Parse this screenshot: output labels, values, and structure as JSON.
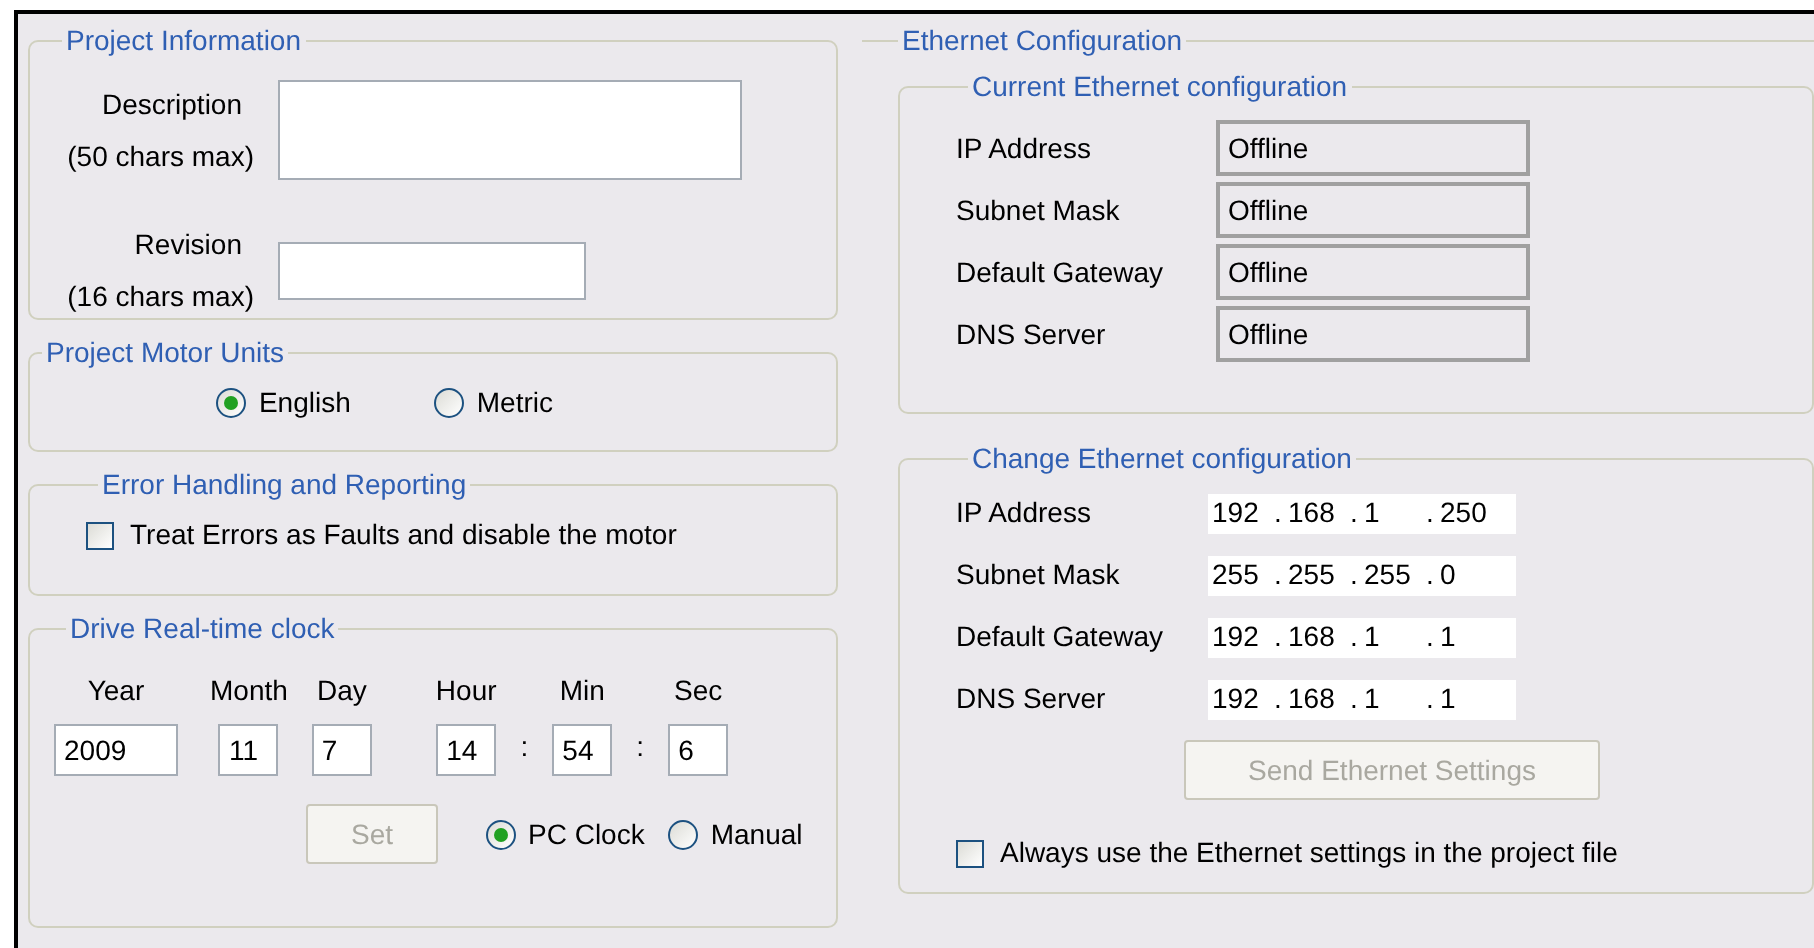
{
  "project_information": {
    "title": "Project Information",
    "fields": [
      {
        "kind": "multiline",
        "label": "Description",
        "limit": "(50 chars max)"
      },
      {
        "kind": "single",
        "label": "Revision",
        "limit": "(16 chars max)"
      }
    ]
  },
  "motor_units": {
    "title": "Project Motor Units",
    "options": [
      {
        "label": "English",
        "selected": true
      },
      {
        "label": "Metric",
        "selected": false
      }
    ]
  },
  "error_handling": {
    "title": "Error Handling and Reporting",
    "checkbox": {
      "label": "Treat Errors as Faults and disable the motor",
      "checked": false
    }
  },
  "real_time_clock": {
    "title": "Drive Real-time clock",
    "fields": [
      {
        "label": "Year",
        "value": "2009"
      },
      {
        "label": "Month",
        "value": "11"
      },
      {
        "label": "Day",
        "value": "7"
      },
      {
        "label": "Hour",
        "value": "14"
      },
      {
        "label": "Min",
        "value": "54",
        "separator_before": ":"
      },
      {
        "label": "Sec",
        "value": "6",
        "separator_before": ":"
      }
    ],
    "set_button": {
      "label": "Set",
      "disabled": true
    },
    "sources": [
      {
        "label": "PC Clock",
        "selected": true
      },
      {
        "label": "Manual",
        "selected": false
      }
    ]
  },
  "ethernet": {
    "title": "Ethernet Configuration",
    "current": {
      "title": "Current Ethernet configuration",
      "rows": [
        {
          "label": "IP Address",
          "value": "Offline"
        },
        {
          "label": "Subnet Mask",
          "value": "Offline"
        },
        {
          "label": "Default Gateway",
          "value": "Offline"
        },
        {
          "label": "DNS Server",
          "value": "Offline"
        }
      ]
    },
    "change": {
      "title": "Change Ethernet configuration",
      "separator": ".",
      "rows": [
        {
          "label": "IP Address",
          "octets": [
            "192",
            "168",
            "1",
            "250"
          ]
        },
        {
          "label": "Subnet Mask",
          "octets": [
            "255",
            "255",
            "255",
            "0"
          ]
        },
        {
          "label": "Default Gateway",
          "octets": [
            "192",
            "168",
            "1",
            "1"
          ]
        },
        {
          "label": "DNS Server",
          "octets": [
            "192",
            "168",
            "1",
            "1"
          ]
        }
      ],
      "send_button": {
        "label": "Send Ethernet Settings",
        "disabled": true
      },
      "checkbox": {
        "label": "Always use the Ethernet settings in the project file",
        "checked": false
      }
    }
  }
}
